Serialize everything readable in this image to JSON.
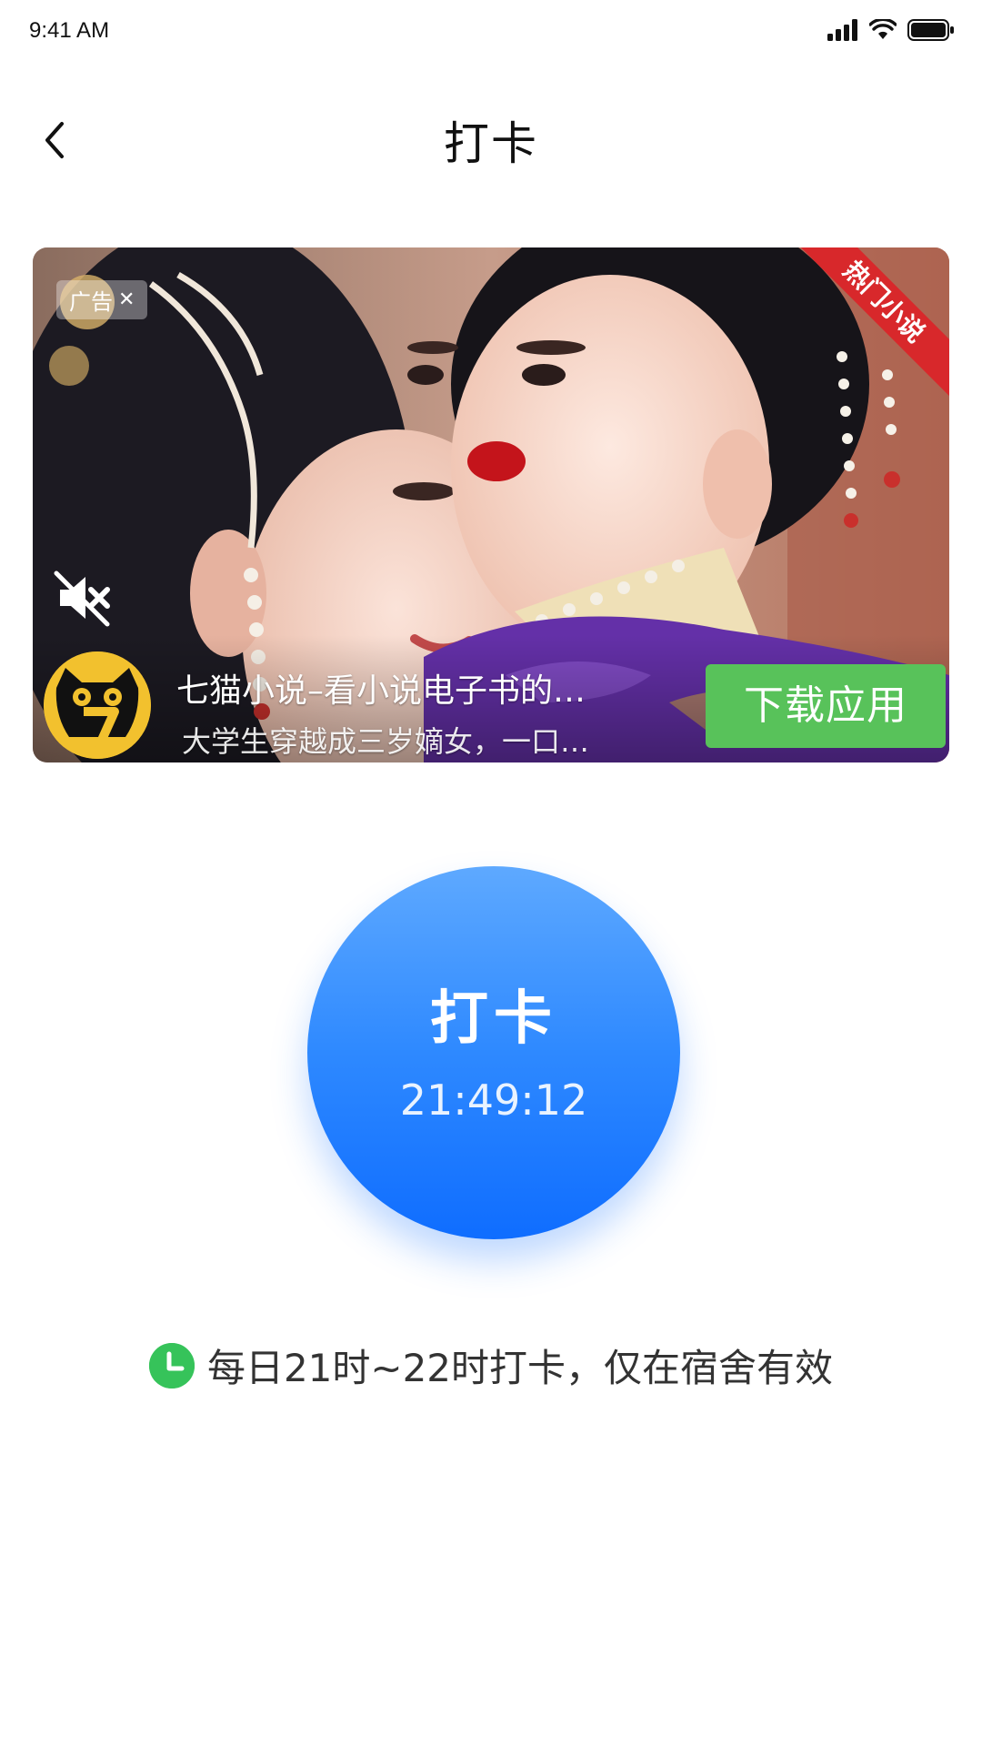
{
  "status_bar": {
    "time": "9:41 AM"
  },
  "nav": {
    "title": "打卡"
  },
  "ad": {
    "tag": "广告",
    "ribbon": "热门小说",
    "app_name": "七猫小说–看小说电子书的…",
    "description": "大学生穿越成三岁嫡女，一口…",
    "download_label": "下载应用"
  },
  "punch": {
    "label": "打卡",
    "time": "21:49:12"
  },
  "hint": {
    "text": "每日21时~22时打卡，仅在宿舍有效"
  },
  "colors": {
    "punch_gradient_top": "#5ea9ff",
    "punch_gradient_bottom": "#0f6dff",
    "download_green": "#58c25a",
    "hint_icon_green": "#36c35a",
    "ribbon_red": "#d8282b"
  }
}
